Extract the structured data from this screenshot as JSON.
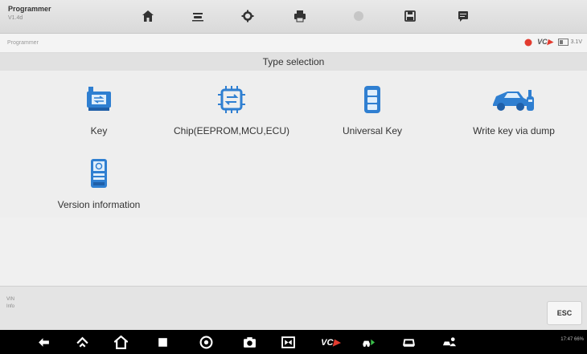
{
  "app": {
    "title": "Programmer",
    "version": "V1.4d"
  },
  "toolbar": {
    "icons": [
      "home-icon",
      "vehicle-lift-icon",
      "settings-gear-icon",
      "printer-icon",
      "help-icon",
      "save-icon",
      "message-icon"
    ]
  },
  "breadcrumb": "Programmer",
  "status": {
    "vci_label": "VC",
    "battery_label": "3.1V"
  },
  "section_title": "Type selection",
  "tiles": [
    {
      "label": "Key",
      "icon": "remote-key-icon"
    },
    {
      "label": "Chip(EEPROM,MCU,ECU)",
      "icon": "chip-icon"
    },
    {
      "label": "Universal Key",
      "icon": "universal-key-icon"
    },
    {
      "label": "Write key via dump",
      "icon": "car-key-icon"
    },
    {
      "label": "Version information",
      "icon": "version-info-icon"
    }
  ],
  "footer": {
    "info_line1": "VIN",
    "info_line2": "Info",
    "esc_label": "ESC"
  },
  "navbar": {
    "vci_label": "VC",
    "system_status": "17:47 66%"
  },
  "colors": {
    "accent_blue": "#2f7fd1",
    "status_red": "#e23b2f",
    "toolbar_gray": "#dedede"
  }
}
